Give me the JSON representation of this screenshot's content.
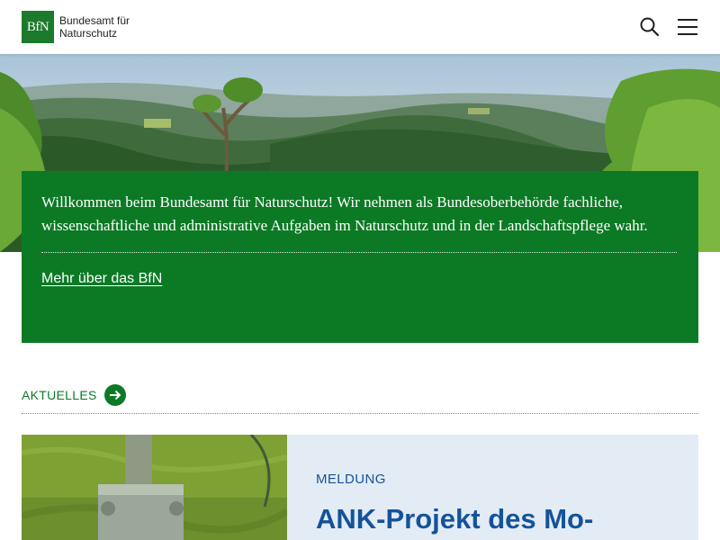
{
  "header": {
    "logo_mark": "BfN",
    "logo_line1": "Bundesamt für",
    "logo_line2": "Naturschutz",
    "search_icon": "search-icon",
    "menu_icon": "hamburger-menu-icon"
  },
  "welcome": {
    "text": "Willkommen beim Bundesamt für Naturschutz! Wir nehmen als Bundesoberbehörde fachliche, wissenschaftliche und administrative Aufgaben im Naturschutz und in der Landschaftspflege wahr.",
    "link_label": "Mehr über das BfN"
  },
  "news": {
    "section_label": "AKTUELLES",
    "arrow_icon": "arrow-right-icon",
    "card": {
      "kicker": "MELDUNG",
      "title": "ANK-Projekt des Mo-"
    }
  },
  "colors": {
    "brand_green": "#0c7a25",
    "card_blue": "#14539a",
    "card_bg": "#e3ecf4"
  }
}
